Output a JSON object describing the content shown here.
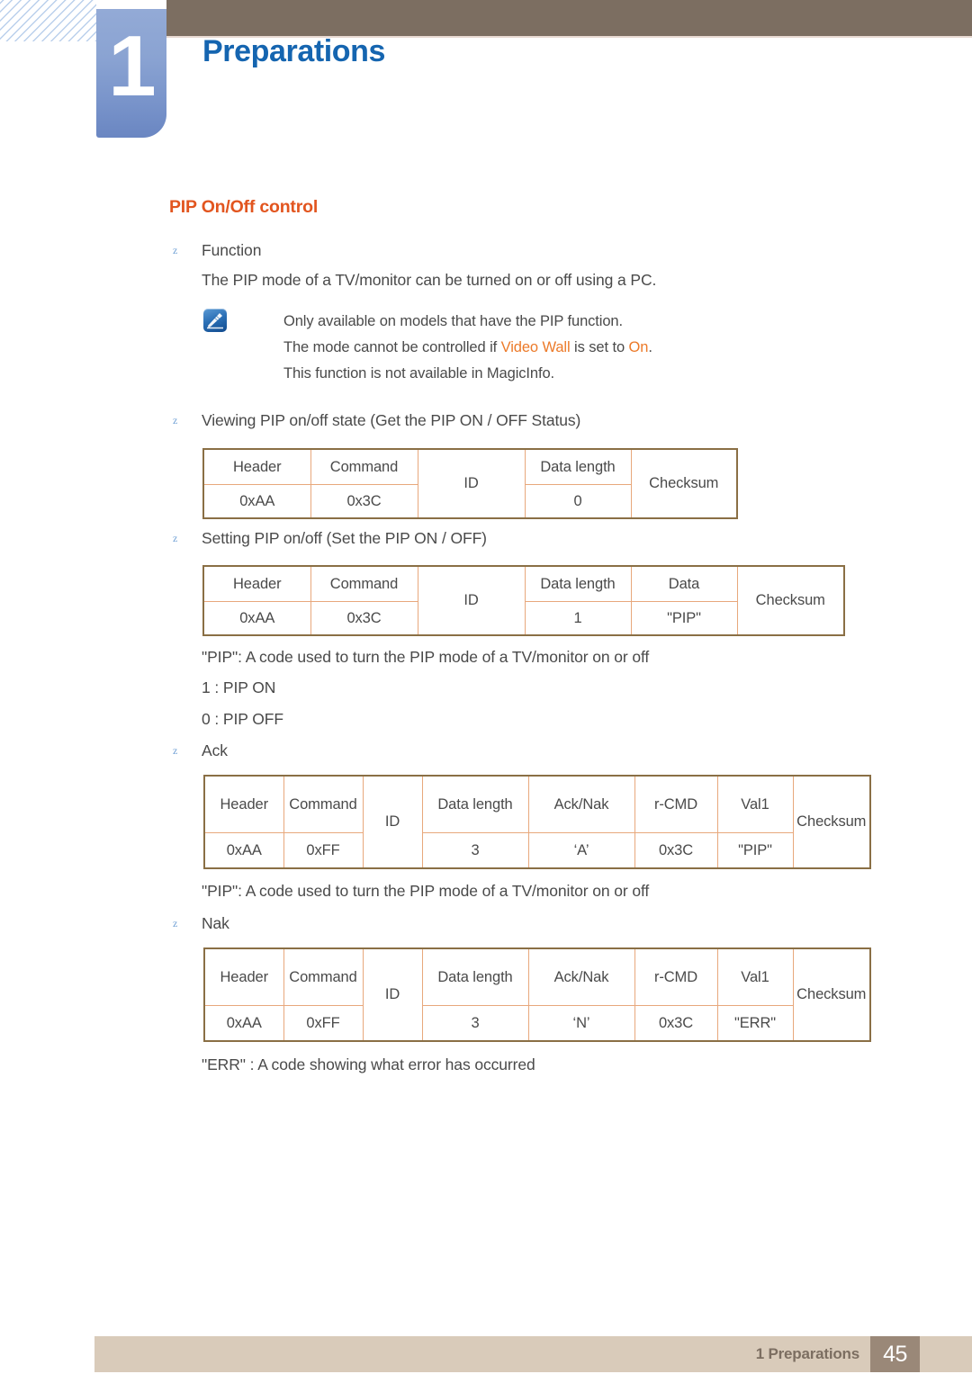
{
  "header": {
    "chapter_number": "1",
    "chapter_title": "Preparations"
  },
  "section": {
    "title": "PIP On/Off control"
  },
  "bullets": {
    "function_label": "Function",
    "function_desc": "The PIP mode of a TV/monitor can be turned on or off using a PC.",
    "viewing_label": "Viewing PIP on/off state (Get the PIP ON / OFF Status)",
    "setting_label": "Setting PIP on/off (Set the PIP ON / OFF)",
    "ack_label": "Ack",
    "nak_label": "Nak",
    "bullet_glyph": "z"
  },
  "note": {
    "line1": "Only available on models that have the PIP function.",
    "line2_a": "The mode cannot be controlled if ",
    "line2_hl1": "Video Wall",
    "line2_b": " is set to ",
    "line2_hl2": "On",
    "line2_c": ".",
    "line3": "This function is not available in MagicInfo.",
    "icon": "note-pen-icon"
  },
  "notes_after_tables": {
    "pip_code_1": "\"PIP\": A code used to turn the PIP mode of a TV/monitor on or off",
    "pip_on": "1 : PIP ON",
    "pip_off": "0 : PIP OFF",
    "pip_code_2": "\"PIP\": A code used to turn the PIP mode of a TV/monitor on or off",
    "err_code": "\"ERR\" : A code showing what error has occurred"
  },
  "tables": {
    "get_status": {
      "headers": [
        "Header",
        "Command",
        "ID",
        "Data length",
        "Checksum"
      ],
      "values": [
        "0xAA",
        "0x3C",
        "",
        "0",
        ""
      ]
    },
    "set_onoff": {
      "headers": [
        "Header",
        "Command",
        "ID",
        "Data length",
        "Data",
        "Checksum"
      ],
      "values": [
        "0xAA",
        "0x3C",
        "",
        "1",
        "\"PIP\"",
        ""
      ]
    },
    "ack": {
      "headers": [
        "Header",
        "Command",
        "ID",
        "Data length",
        "Ack/Nak",
        "r-CMD",
        "Val1",
        "Checksum"
      ],
      "values": [
        "0xAA",
        "0xFF",
        "",
        "3",
        "‘A’",
        "0x3C",
        "\"PIP\"",
        ""
      ]
    },
    "nak": {
      "headers": [
        "Header",
        "Command",
        "ID",
        "Data length",
        "Ack/Nak",
        "r-CMD",
        "Val1",
        "Checksum"
      ],
      "values": [
        "0xAA",
        "0xFF",
        "",
        "3",
        "‘N’",
        "0x3C",
        "\"ERR\"",
        ""
      ]
    }
  },
  "footer": {
    "label": "1 Preparations",
    "page": "45"
  },
  "colors": {
    "header_bar": "#7c6e61",
    "chapter_tab": "#8aa3d2",
    "chapter_title": "#1565b0",
    "section_title": "#e2551f",
    "highlight": "#ec7a29",
    "table_outer_border": "#8a6f45",
    "table_inner_border": "#e8a87c",
    "footer_bar": "#d9cbba",
    "footer_page_box": "#9a8878"
  }
}
